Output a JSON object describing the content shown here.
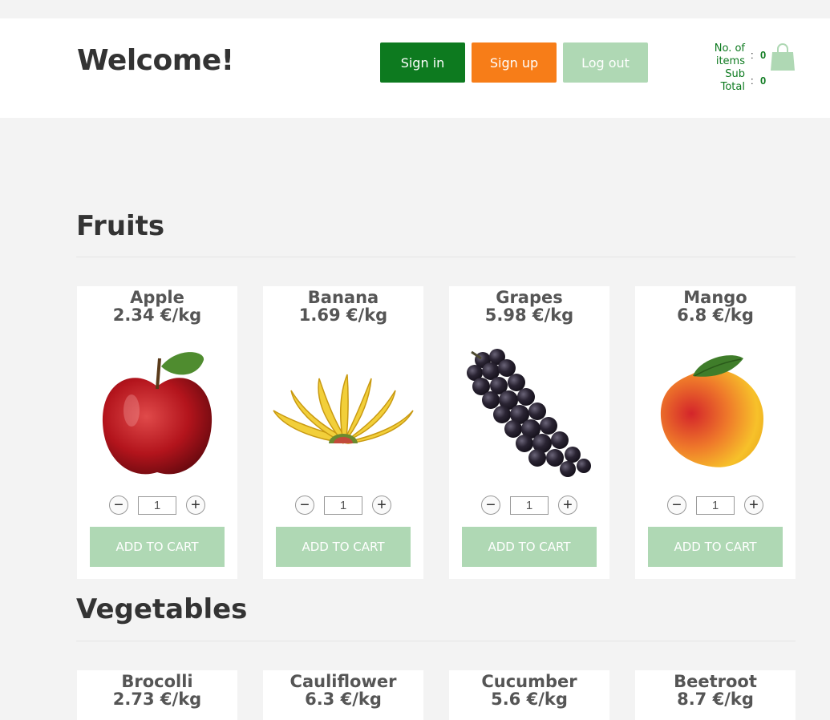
{
  "header": {
    "welcome": "Welcome!",
    "signin_label": "Sign in",
    "signup_label": "Sign up",
    "logout_label": "Log out",
    "cart": {
      "items_label_line1": "No. of",
      "items_label_line2": "items",
      "subtotal_label_line1": "Sub",
      "subtotal_label_line2": "Total",
      "separator": ":",
      "items_count": "0",
      "subtotal": "0",
      "icon": "shopping-bag-icon"
    }
  },
  "sections": {
    "fruits": {
      "title": "Fruits",
      "products": [
        {
          "name": "Apple",
          "price": "2.34 €/kg",
          "qty": "1",
          "add_label": "ADD TO CART",
          "minus": "−",
          "plus": "+"
        },
        {
          "name": "Banana",
          "price": "1.69 €/kg",
          "qty": "1",
          "add_label": "ADD TO CART",
          "minus": "−",
          "plus": "+"
        },
        {
          "name": "Grapes",
          "price": "5.98 €/kg",
          "qty": "1",
          "add_label": "ADD TO CART",
          "minus": "−",
          "plus": "+"
        },
        {
          "name": "Mango",
          "price": "6.8 €/kg",
          "qty": "1",
          "add_label": "ADD TO CART",
          "minus": "−",
          "plus": "+"
        }
      ]
    },
    "vegetables": {
      "title": "Vegetables",
      "products": [
        {
          "name": "Brocolli",
          "price": "2.73 €/kg"
        },
        {
          "name": "Cauliflower",
          "price": "6.3 €/kg"
        },
        {
          "name": "Cucumber",
          "price": "5.6 €/kg"
        },
        {
          "name": "Beetroot",
          "price": "8.7 €/kg"
        }
      ]
    }
  },
  "colors": {
    "primary_green": "#0d7a1f",
    "orange": "#f77d18",
    "light_green": "#afd8b4",
    "background": "#f3f3f3"
  }
}
